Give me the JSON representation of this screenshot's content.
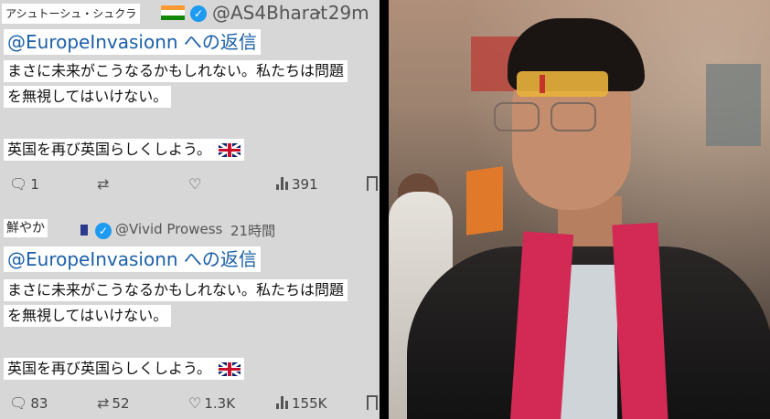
{
  "tweets": [
    {
      "display_name": "アシュトーシュ・シュクラ",
      "handle": "@AS4Bharat",
      "time": "· 29m",
      "reply_to": "@EuropeInvasionn への返信",
      "line1": "まさに未来がこうなるかもしれない。私たちは問題",
      "line2": "を無視してはいけない。",
      "line3": "英国を再び英国らしくしよう。",
      "replies": "1",
      "retweets": "",
      "likes": "",
      "views": "391"
    },
    {
      "display_name": "鮮やか",
      "handle": "@Vivid Prowess",
      "time": "21時間",
      "reply_to": "@EuropeInvasionn への返信",
      "line1": "まさに未来がこうなるかもしれない。私たちは問題",
      "line2": "を無視してはいけない。",
      "line3": "英国を再び英国らしくしよう。",
      "replies": "83",
      "retweets": "52",
      "likes": "1.3K",
      "views": "155K"
    }
  ],
  "icons": {
    "reply": "reply-icon",
    "retweet": "retweet-icon",
    "like": "heart-icon",
    "views": "views-icon",
    "bookmark": "bookmark-icon",
    "verified": "verified-badge-icon"
  },
  "colors": {
    "panel_bg": "#d7d7d7",
    "link_blue": "#1a5fa8",
    "verified_blue": "#1d9bf0",
    "scarf_pink": "#d22a55"
  }
}
